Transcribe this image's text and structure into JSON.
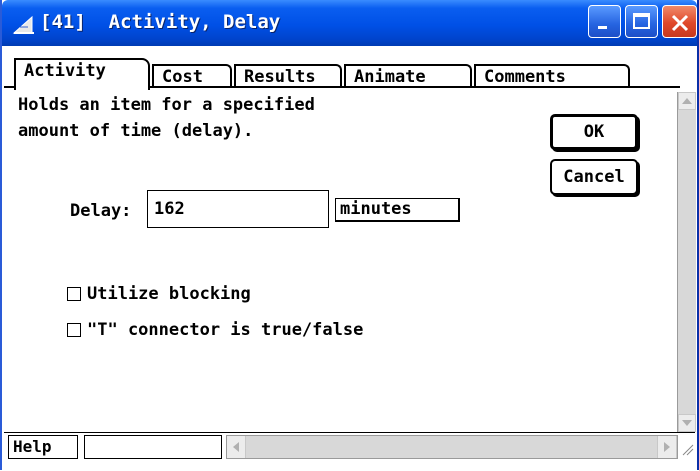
{
  "window": {
    "title": "[41]  Activity, Delay",
    "title_color": "#0050e6"
  },
  "tabs": [
    {
      "label": "Activity",
      "active": true
    },
    {
      "label": "Cost",
      "active": false
    },
    {
      "label": "Results",
      "active": false
    },
    {
      "label": "Animate",
      "active": false
    },
    {
      "label": "Comments",
      "active": false
    }
  ],
  "content": {
    "description": "Holds an item for a specified\namount of time (delay).",
    "delay_label": "Delay:",
    "delay_value": "162",
    "units": "minutes",
    "checkboxes": [
      {
        "label": "Utilize blocking",
        "checked": false
      },
      {
        "label": "\"T\" connector is true/false",
        "checked": false
      }
    ]
  },
  "buttons": {
    "ok": "OK",
    "cancel": "Cancel"
  },
  "footer": {
    "help": "Help",
    "status_text": ""
  }
}
